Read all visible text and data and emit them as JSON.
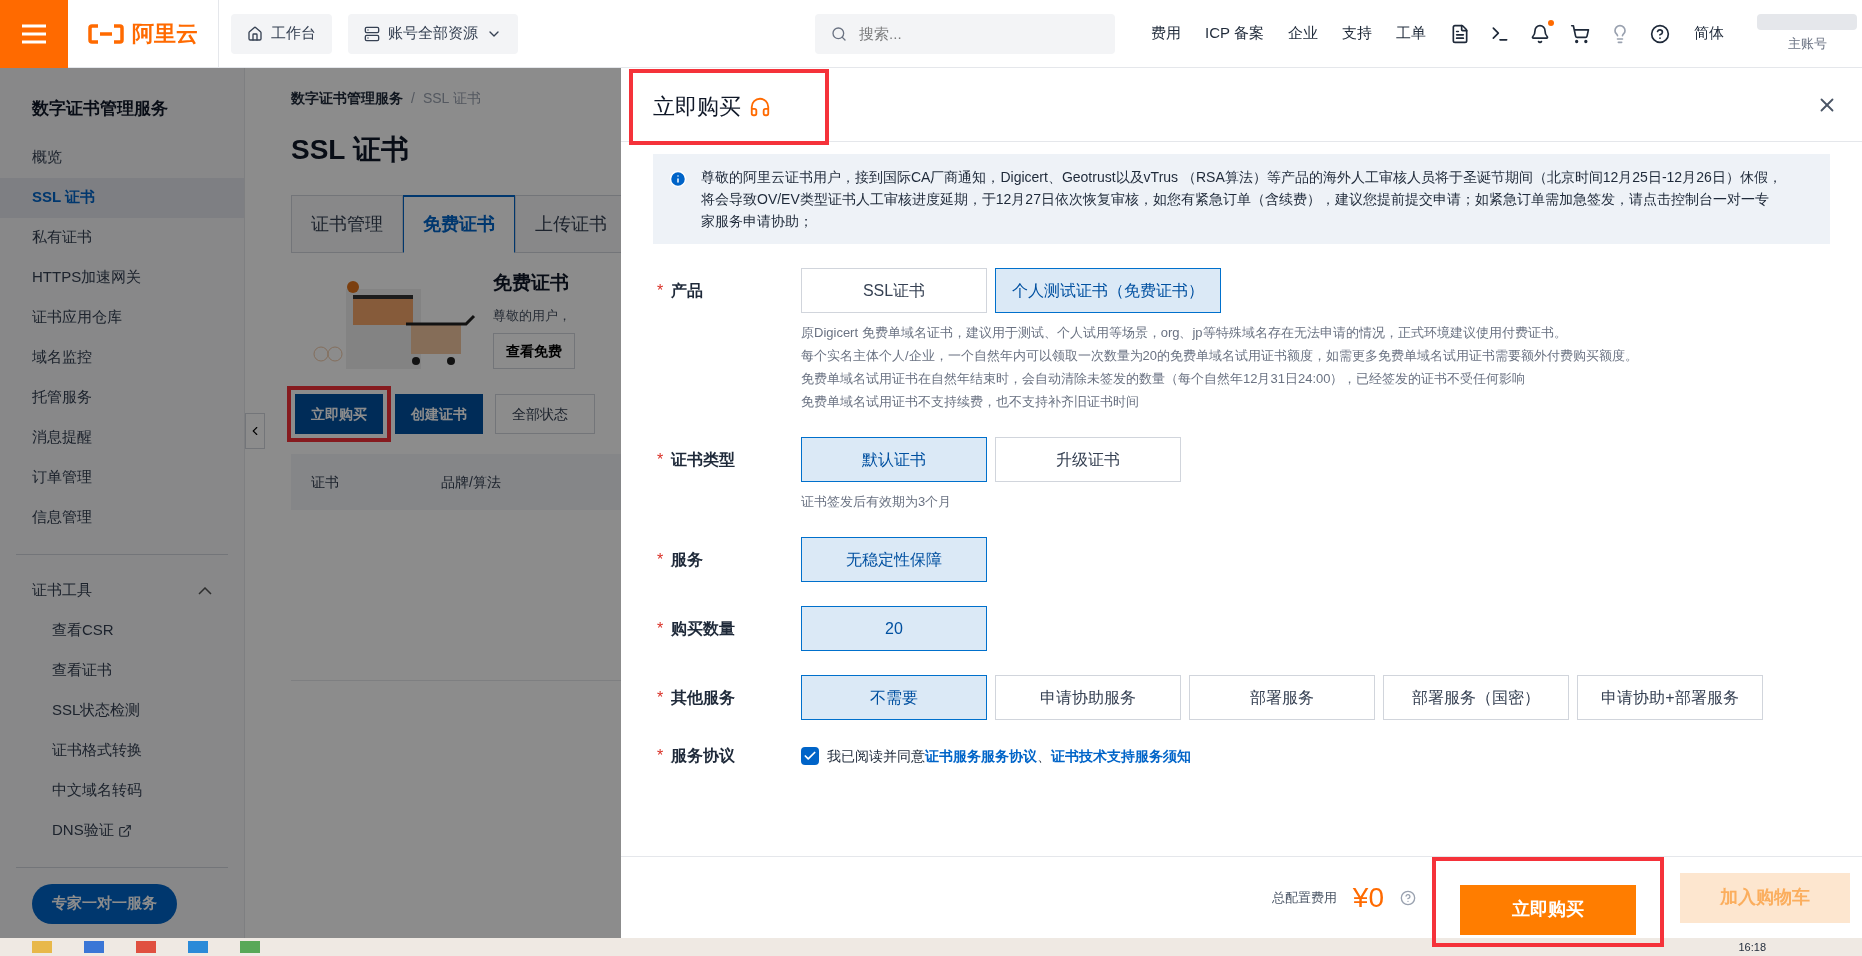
{
  "topbar": {
    "logo": "阿里云",
    "workbench": "工作台",
    "resources": "账号全部资源",
    "search": {
      "placeholder": "搜索..."
    },
    "nav": [
      "费用",
      "ICP 备案",
      "企业",
      "支持",
      "工单"
    ],
    "notification_dot": true,
    "language": "简体",
    "account": "主账号"
  },
  "sidebar": {
    "title": "数字证书管理服务",
    "items": [
      {
        "label": "概览",
        "selected": false
      },
      {
        "label": "SSL 证书",
        "selected": true
      },
      {
        "label": "私有证书",
        "selected": false
      },
      {
        "label": "HTTPS加速网关",
        "selected": false
      },
      {
        "label": "证书应用仓库",
        "selected": false
      },
      {
        "label": "域名监控",
        "selected": false
      },
      {
        "label": "托管服务",
        "selected": false
      },
      {
        "label": "消息提醒",
        "selected": false
      },
      {
        "label": "订单管理",
        "selected": false
      },
      {
        "label": "信息管理",
        "selected": false
      }
    ],
    "group": {
      "label": "证书工具",
      "expanded": true,
      "children": [
        {
          "label": "查看CSR",
          "external": false
        },
        {
          "label": "查看证书",
          "external": false
        },
        {
          "label": "SSL状态检测",
          "external": false
        },
        {
          "label": "证书格式转换",
          "external": false
        },
        {
          "label": "中文域名转码",
          "external": false
        },
        {
          "label": "DNS验证",
          "external": true
        }
      ]
    },
    "expert_button": "专家一对一服务"
  },
  "page": {
    "breadcrumb": [
      "数字证书管理服务",
      "SSL 证书"
    ],
    "breadcrumb_separator": "/",
    "title": "SSL 证书",
    "tabs": [
      {
        "label": "证书管理",
        "selected": false
      },
      {
        "label": "免费证书",
        "selected": true
      },
      {
        "label": "上传证书",
        "selected": false
      }
    ],
    "banner": {
      "title": "免费证书",
      "text": "尊敬的用户，",
      "button": "查看免费"
    },
    "actions": [
      {
        "label": "立即购买",
        "highlighted": true
      },
      {
        "label": "创建证书",
        "highlighted": false
      }
    ],
    "status_select": "全部状态",
    "columns": [
      "证书",
      "品牌/算法"
    ]
  },
  "dialog": {
    "title": "立即购买",
    "title_highlighted": true,
    "notice": "尊敬的阿里云证书用户，接到国际CA厂商通知，Digicert、Geotrust以及vTrus （RSA算法）等产品的海外人工审核人员将于圣诞节期间（北京时间12月25日-12月26日）休假，将会导致OV/EV类型证书人工审核进度延期，于12月27日依次恢复审核，如您有紧急订单（含续费），建议您提前提交申请；如紧急订单需加急签发，请点击控制台一对一专家服务申请协助；",
    "fields": [
      {
        "label": "产品",
        "required_mark": "*",
        "options": [
          {
            "label": "SSL证书",
            "selected": false
          },
          {
            "label": "个人测试证书（免费证书）",
            "selected": true
          }
        ],
        "hints": [
          "原Digicert 免费单域名证书，建议用于测试、个人试用等场景，org、jp等特殊域名存在无法申请的情况，正式环境建议使用付费证书。",
          "每个实名主体个人/企业，一个自然年内可以领取一次数量为20的免费单域名试用证书额度，如需更多免费单域名试用证书需要额外付费购买额度。",
          "免费单域名试用证书在自然年结束时，会自动清除未签发的数量（每个自然年12月31日24:00），已经签发的证书不受任何影响",
          "免费单域名试用证书不支持续费，也不支持补齐旧证书时间"
        ]
      },
      {
        "label": "证书类型",
        "required_mark": "*",
        "options": [
          {
            "label": "默认证书",
            "selected": true
          },
          {
            "label": "升级证书",
            "selected": false
          }
        ],
        "hints": [
          "证书签发后有效期为3个月"
        ]
      },
      {
        "label": "服务",
        "required_mark": "*",
        "options": [
          {
            "label": "无稳定性保障",
            "selected": true
          }
        ]
      },
      {
        "label": "购买数量",
        "required_mark": "*",
        "options": [
          {
            "label": "20",
            "selected": true
          }
        ]
      },
      {
        "label": "其他服务",
        "required_mark": "*",
        "options": [
          {
            "label": "不需要",
            "selected": true
          },
          {
            "label": "申请协助服务",
            "selected": false
          },
          {
            "label": "部署服务",
            "selected": false
          },
          {
            "label": "部署服务（国密）",
            "selected": false
          },
          {
            "label": "申请协助+部署服务",
            "selected": false
          }
        ]
      }
    ],
    "agreement": {
      "label": "服务协议",
      "required_mark": "*",
      "checked": true,
      "text": "我已阅读并同意",
      "links": [
        "证书服务服务协议",
        "证书技术支持服务须知"
      ],
      "separator": "、"
    },
    "footer": {
      "total_label": "总配置费用",
      "total": "¥0",
      "buy": "立即购买",
      "buy_highlighted": true,
      "cart": "加入购物车"
    }
  },
  "taskbar": {
    "clock": "16:18"
  }
}
